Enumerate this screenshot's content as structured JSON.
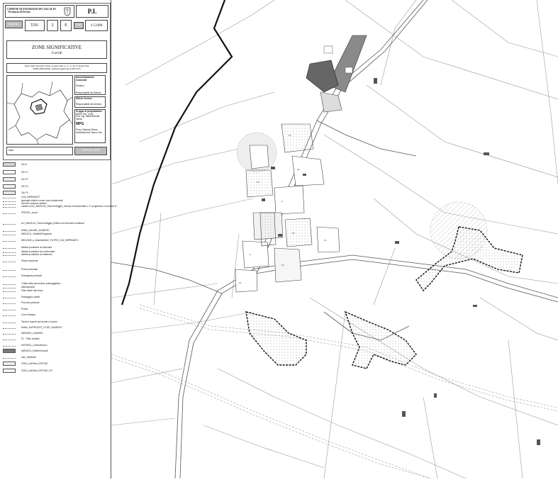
{
  "header": {
    "comune": "COMUNE DI SAN BIAGIO DI CALLALTA - Provincia di Treviso",
    "plan_code": "P.I.",
    "elaborato": "Elaborato",
    "tav_label": "TAV.",
    "tav_number": "2",
    "tav_letter": "E",
    "scala_label": "Scala",
    "scale": "1:5.000",
    "title": "ZONE SIGNIFICATIVE",
    "subtitle": "Cavriè",
    "plan_note": "Piano degli interventi redatto ai sensi della L.r. n. 11 del 23 aprile 2004",
    "plan_subnote": "(PRIMA REDAZIONE - Elaborato aggiornato al 2015-XXX)",
    "amm_title": "Amministrazione Comunale",
    "amm_lines": [
      "Sindaco",
      "Responsabile del Settore"
    ],
    "uff_title": "Ufficio Tecnico",
    "uff_lines": [
      "Responsabile del servizio"
    ],
    "prog_title": "Gruppo di progettazione",
    "prog_lines": [
      "MATE Soc. Coop.",
      "Prof. Ing. Maria Antonia Tamai"
    ],
    "logo_text": "MPG",
    "prog_extra": [
      "Prog. Gianluca Ramo",
      "Urbanista dott. Marco Gal"
    ],
    "footer_label": "Data",
    "date": "Dicembre 2015"
  },
  "legend": [
    {
      "label": "Zto A",
      "swatch": "#d8d8d8"
    },
    {
      "label": "Zto F1",
      "swatch": "#ffffff"
    },
    {
      "label": "Zto F2",
      "swatch": "#eeeeee"
    },
    {
      "label": "Zto F3",
      "swatch": "#f4f4f4"
    },
    {
      "label": "Zto F4",
      "swatch": "#e4e4e4"
    },
    {
      "label": "Civil_IMPRIMATO",
      "swatch": "none"
    },
    {
      "label": "tipologie edilizie nuove zone residenziali",
      "swatch": "none"
    },
    {
      "label": "Numero restauro edilizio",
      "swatch": "none"
    },
    {
      "label": "Labels of AG_b5001111_PianoVolAggiti_Vincolo monumentale e n° progressivo di schede B",
      "swatch": "none"
    },
    {
      "label": "PREVEL_icona",
      "swatch": "none"
    },
    {
      "label": "AG_b5001111_PianoVolAggiti_Edifici con interventi codificati",
      "swatch": "none"
    },
    {
      "label": "Edifici_UNUMO_NUMERO",
      "swatch": "none"
    },
    {
      "label": "b5001121_ViabilitaProgramm",
      "swatch": "none"
    },
    {
      "label": "DBC2008_a_dbambiente2_FILTRO_Civil_IMPRIMATO",
      "swatch": "none"
    },
    {
      "label": "Attività produttive da bloccare",
      "swatch": "none"
    },
    {
      "label": "Attività produttive da confermare",
      "swatch": "none"
    },
    {
      "label": "Attività produttive da trasferire",
      "swatch": "none"
    },
    {
      "label": "Piazze pedonali",
      "swatch": "none"
    },
    {
      "label": "Ponte pedonale",
      "swatch": "none"
    },
    {
      "label": "Sottopassi pedonali",
      "swatch": "none"
    },
    {
      "label": "Tutela della percezione paesaggistica",
      "swatch": "none"
    },
    {
      "label": "Alberaturatal",
      "swatch": "none"
    },
    {
      "label": "Filari alberi alto fusto",
      "swatch": "none"
    },
    {
      "label": "Passaggio coperti",
      "swatch": "none"
    },
    {
      "label": "Percorsi pedonali",
      "swatch": "none"
    },
    {
      "label": "Portici",
      "swatch": "none"
    },
    {
      "label": "Corsi d'acqua",
      "swatch": "none"
    },
    {
      "label": "Territori coperti da foreste e boschi",
      "swatch": "none"
    },
    {
      "label": "Edifici_livePRODOT_b7187_NUMERO",
      "swatch": "none"
    },
    {
      "label": "b5003521_AmbitiSD",
      "swatch": "none"
    },
    {
      "label": "01 - Piste ciclabili",
      "swatch": "none"
    },
    {
      "label": "b5700511_CentroStorico",
      "swatch": "none"
    },
    {
      "label": "b5003211_EdificiVincolati",
      "swatch": "#7a7a7a"
    },
    {
      "label": "cati_mediticati",
      "swatch": "none"
    },
    {
      "label": "Z000_Lotti liberi_RETINO",
      "swatch": "#eeeeee"
    },
    {
      "label": "Z000_Lotti liberi_RETINO_EX",
      "swatch": "#f4f4f4"
    }
  ]
}
